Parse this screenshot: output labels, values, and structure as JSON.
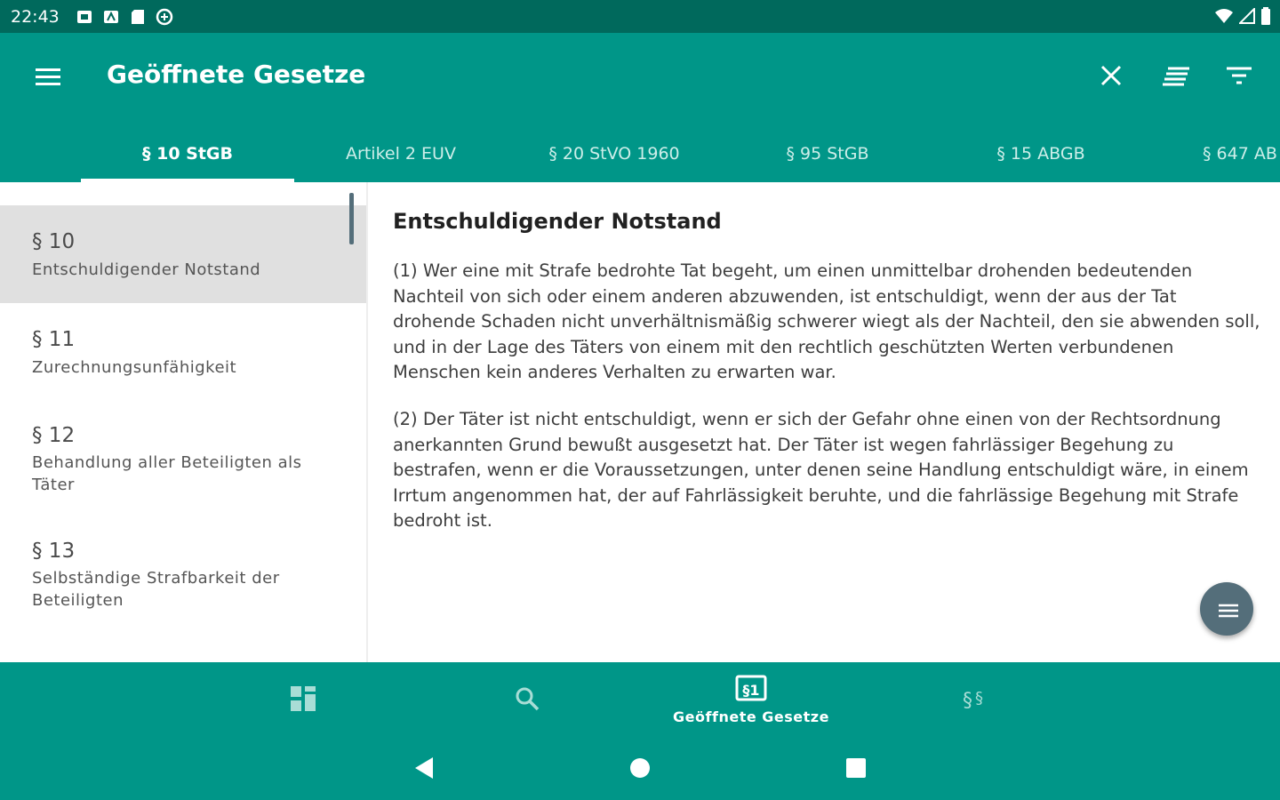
{
  "status_bar": {
    "time": "22:43",
    "left_icons": [
      "notification-icon",
      "notification-icon",
      "sd-card-icon",
      "sync-icon"
    ],
    "right_icons": [
      "wifi-icon",
      "signal-icon",
      "battery-icon"
    ]
  },
  "app_bar": {
    "title": "Geöffnete Gesetze",
    "actions": [
      "close-icon",
      "sort-icon",
      "filter-icon"
    ]
  },
  "tabs": [
    {
      "label": "§ 10 StGB",
      "active": true
    },
    {
      "label": "Artikel 2 EUV",
      "active": false
    },
    {
      "label": "§ 20 StVO 1960",
      "active": false
    },
    {
      "label": "§ 95 StGB",
      "active": false
    },
    {
      "label": "§ 15 ABGB",
      "active": false
    },
    {
      "label": "§ 647 AB",
      "active": false
    }
  ],
  "toc": [
    {
      "number": "§ 10",
      "title": "Entschuldigender Notstand",
      "selected": true
    },
    {
      "number": "§ 11",
      "title": "Zurechnungsunfähigkeit",
      "selected": false
    },
    {
      "number": "§ 12",
      "title": "Behandlung aller Beteiligten als Täter",
      "selected": false
    },
    {
      "number": "§ 13",
      "title": "Selbständige Strafbarkeit der Beteiligten",
      "selected": false
    }
  ],
  "content": {
    "title": "Entschuldigender Notstand",
    "paragraphs": [
      "(1) Wer eine mit Strafe bedrohte Tat begeht, um einen unmittelbar drohenden bedeutenden Nachteil von sich oder einem anderen abzuwenden, ist entschuldigt, wenn der aus der Tat drohende Schaden nicht unverhältnismäßig schwerer wiegt als der Nachteil, den sie abwenden soll, und in der Lage des Täters von einem mit den rechtlich geschützten Werten verbundenen Menschen kein anderes Verhalten zu erwarten war.",
      "(2) Der Täter ist nicht entschuldigt, wenn er sich der Gefahr ohne einen von der Rechtsordnung anerkannten Grund bewußt ausgesetzt hat. Der Täter ist wegen fahrlässiger Begehung zu bestrafen, wenn er die Voraussetzungen, unter denen seine Handlung entschuldigt wäre, in einem Irrtum angenommen hat, der auf Fahrlässigkeit beruhte, und die fahrlässige Begehung mit Strafe bedroht ist."
    ]
  },
  "bottom_nav": [
    {
      "icon": "dashboard-icon",
      "label": "",
      "active": false
    },
    {
      "icon": "search-icon",
      "label": "",
      "active": false
    },
    {
      "icon": "open-laws-icon",
      "label": "Geöffnete Gesetze",
      "active": true
    },
    {
      "icon": "paragraphs-icon",
      "label": "",
      "active": false
    }
  ],
  "colors": {
    "primary": "#009688",
    "primary_dark": "#00695c",
    "fab": "#546e7a",
    "selected_row": "#e0e0e0"
  }
}
